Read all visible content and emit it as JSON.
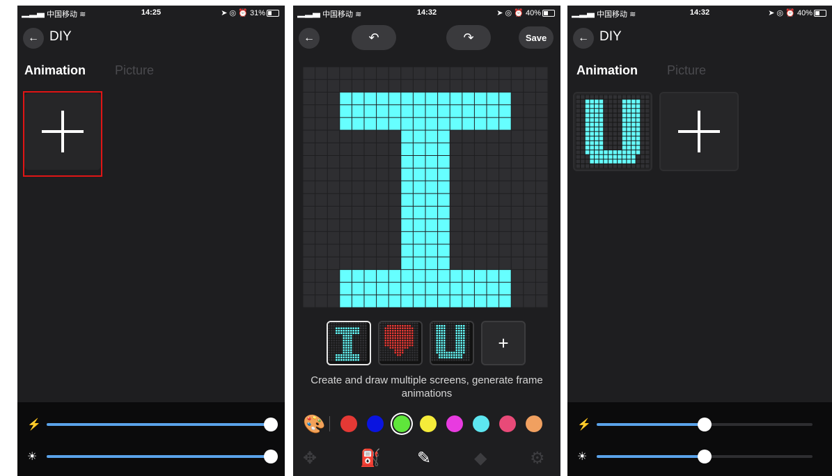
{
  "status_bars": [
    {
      "carrier": "中国移动",
      "time": "14:25",
      "battery": "31%",
      "battery_level": 0.31
    },
    {
      "carrier": "中国移动",
      "time": "14:32",
      "battery": "40%",
      "battery_level": 0.4
    },
    {
      "carrier": "中国移动",
      "time": "14:32",
      "battery": "40%",
      "battery_level": 0.4
    }
  ],
  "diy": {
    "title": "DIY",
    "tabs": [
      "Animation",
      "Picture"
    ]
  },
  "sliders": {
    "screen1": {
      "power_level": 1.0,
      "brightness_level": 1.0
    },
    "screen3": {
      "power_level": 0.5,
      "brightness_level": 0.5
    }
  },
  "editor": {
    "save_label": "Save",
    "hint": "Create and draw multiple screens, generate frame animations",
    "add_frame_label": "+",
    "frames": [
      "letter-I",
      "heart",
      "letter-U"
    ],
    "pixel_color": "#66ffff",
    "cell_color": "#2e2e31",
    "colors": [
      "#e53935",
      "#0a14e0",
      "#5fe63b",
      "#f5ec3a",
      "#e83be0",
      "#5de6f0",
      "#e84a78",
      "#f0a060"
    ],
    "selected_color_index": 2,
    "tools": [
      "move-icon",
      "fill-bucket-icon",
      "pen-icon",
      "eraser-icon",
      "settings-icon"
    ],
    "active_tool": 2
  },
  "accent_color": "#5aa3ea"
}
